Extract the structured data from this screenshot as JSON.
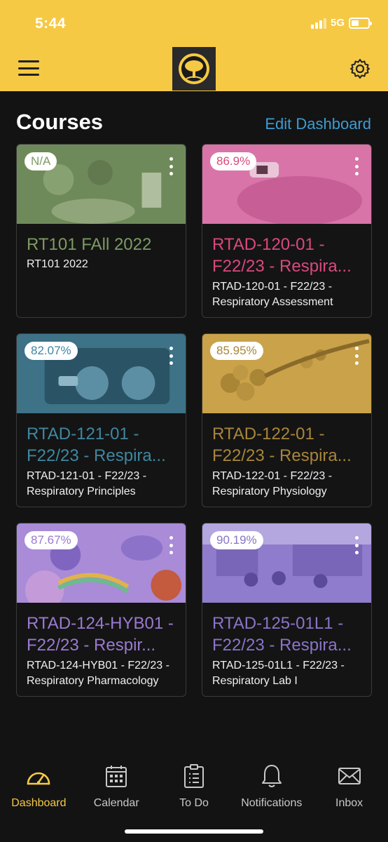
{
  "status": {
    "time": "5:44",
    "network": "5G"
  },
  "header": {
    "menu_icon": "hamburger-menu-icon",
    "logo_icon": "tree-logo-icon",
    "settings_icon": "gear-icon"
  },
  "page": {
    "title": "Courses",
    "edit_label": "Edit Dashboard"
  },
  "courses": [
    {
      "grade": "N/A",
      "title": "RT101 FAll 2022",
      "subtitle": "RT101 2022",
      "color": "#7d9a63",
      "tint": "#8ab269"
    },
    {
      "grade": "86.9%",
      "title": "RTAD-120-01 - F22/23 - Respira...",
      "subtitle": "RTAD-120-01 - F22/23 - Respiratory Assessment",
      "color": "#d9497d",
      "tint": "#de6aa0"
    },
    {
      "grade": "82.07%",
      "title": "RTAD-121-01 - F22/23 - Respira...",
      "subtitle": "RTAD-121-01 - F22/23 - Respiratory Principles",
      "color": "#3f87a1",
      "tint": "#4d8ea6"
    },
    {
      "grade": "85.95%",
      "title": "RTAD-122-01 - F22/23 - Respira...",
      "subtitle": "RTAD-122-01 - F22/23 - Respiratory Physiology",
      "color": "#a8853a",
      "tint": "#c9a24a"
    },
    {
      "grade": "87.67%",
      "title": "RTAD-124-HYB01 - F22/23 - Respir...",
      "subtitle": "RTAD-124-HYB01 - F22/23 - Respiratory Pharmacology",
      "color": "#9a7ad0",
      "tint": "#a98bd8"
    },
    {
      "grade": "90.19%",
      "title": "RTAD-125-01L1 - F22/23 - Respira...",
      "subtitle": "RTAD-125-01L1 - F22/23 - Respiratory Lab I",
      "color": "#8a74c8",
      "tint": "#8f7ccc"
    }
  ],
  "tabs": [
    {
      "label": "Dashboard",
      "icon": "speedometer-icon",
      "active": true
    },
    {
      "label": "Calendar",
      "icon": "calendar-icon",
      "active": false
    },
    {
      "label": "To Do",
      "icon": "clipboard-icon",
      "active": false
    },
    {
      "label": "Notifications",
      "icon": "bell-icon",
      "active": false
    },
    {
      "label": "Inbox",
      "icon": "envelope-icon",
      "active": false
    }
  ],
  "colors": {
    "header": "#f6c945",
    "accent_link": "#3f9bd1",
    "background": "#131313"
  }
}
